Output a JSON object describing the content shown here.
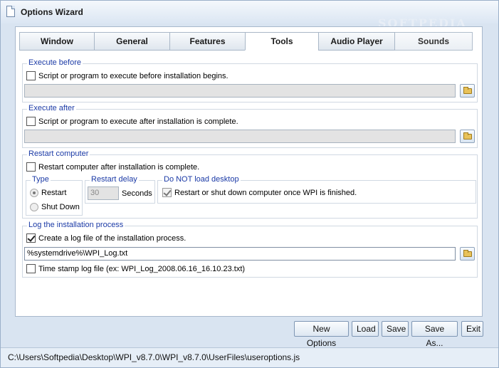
{
  "window": {
    "title": "Options Wizard",
    "watermark": "SOFTPEDIA"
  },
  "tabs": [
    {
      "label": "Window"
    },
    {
      "label": "General"
    },
    {
      "label": "Features"
    },
    {
      "label": "Tools",
      "active": true
    },
    {
      "label": "Audio Player"
    },
    {
      "label": "Sounds"
    }
  ],
  "execute_before": {
    "legend": "Execute before",
    "checkbox_label": "Script or program to execute before installation begins.",
    "checked": false,
    "path_value": ""
  },
  "execute_after": {
    "legend": "Execute after",
    "checkbox_label": "Script or program to execute after installation is complete.",
    "checked": false,
    "path_value": ""
  },
  "restart": {
    "legend": "Restart computer",
    "checkbox_label": "Restart computer after installation is complete.",
    "checked": false,
    "type": {
      "legend": "Type",
      "options": [
        {
          "label": "Restart",
          "selected": true
        },
        {
          "label": "Shut Down",
          "selected": false
        }
      ]
    },
    "delay": {
      "legend": "Restart delay",
      "value": "30",
      "unit": "Seconds"
    },
    "desktop": {
      "legend": "Do NOT load desktop",
      "checkbox_label": "Restart or shut down computer once WPI is finished.",
      "checked": true
    }
  },
  "log": {
    "legend": "Log the installation process",
    "checkbox_label": "Create a log file of the installation process.",
    "checked": true,
    "path_value": "%systemdrive%\\WPI_Log.txt",
    "timestamp_label": "Time stamp log file (ex: WPI_Log_2008.06.16_16.10.23.txt)",
    "timestamp_checked": false
  },
  "buttons": {
    "new_options": "New Options",
    "load": "Load",
    "save": "Save",
    "save_as": "Save As...",
    "exit": "Exit"
  },
  "status": {
    "path": "C:\\Users\\Softpedia\\Desktop\\WPI_v8.7.0\\WPI_v8.7.0\\UserFiles\\useroptions.js"
  },
  "icons": {
    "browse": "folder-icon",
    "app": "document-icon"
  }
}
